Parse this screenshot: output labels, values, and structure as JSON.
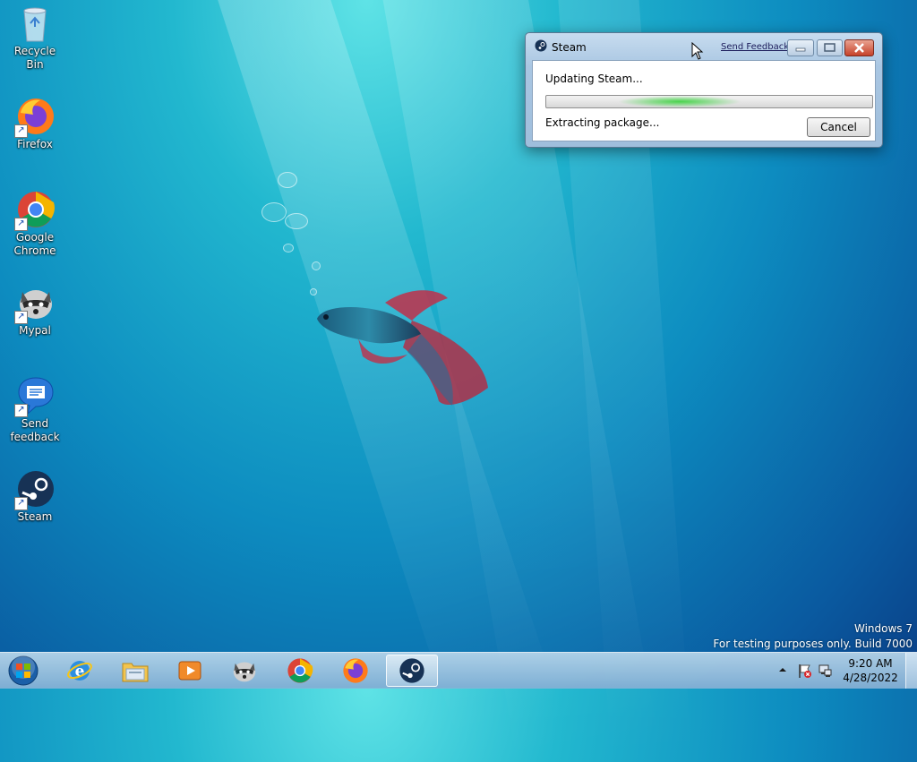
{
  "desktop": {
    "icons": [
      {
        "label": "Recycle Bin",
        "icon": "recycle-bin-icon"
      },
      {
        "label": "Firefox",
        "icon": "firefox-icon"
      },
      {
        "label": "Google Chrome",
        "icon": "chrome-icon"
      },
      {
        "label": "Mypal",
        "icon": "mypal-icon"
      },
      {
        "label": "Send feedback",
        "icon": "send-feedback-icon"
      },
      {
        "label": "Steam",
        "icon": "steam-icon"
      }
    ],
    "watermark": {
      "line1": "Windows 7",
      "line2": "For testing purposes only. Build 7000"
    }
  },
  "steam_dialog": {
    "title": "Steam",
    "feedback_link": "Send Feedback",
    "status": "Updating Steam...",
    "detail": "Extracting package...",
    "cancel_label": "Cancel"
  },
  "taskbar": {
    "items": [
      "start-orb",
      "internet-explorer-icon",
      "windows-explorer-icon",
      "media-player-icon",
      "mypal-icon",
      "chrome-icon",
      "firefox-icon",
      "steam-icon"
    ],
    "active_item": "steam-icon",
    "clock": {
      "time": "9:20 AM",
      "date": "4/28/2022"
    }
  },
  "colors": {
    "accent": "#0d8cc0",
    "progress_glow": "#49d34c",
    "close_button": "#c6422a"
  }
}
